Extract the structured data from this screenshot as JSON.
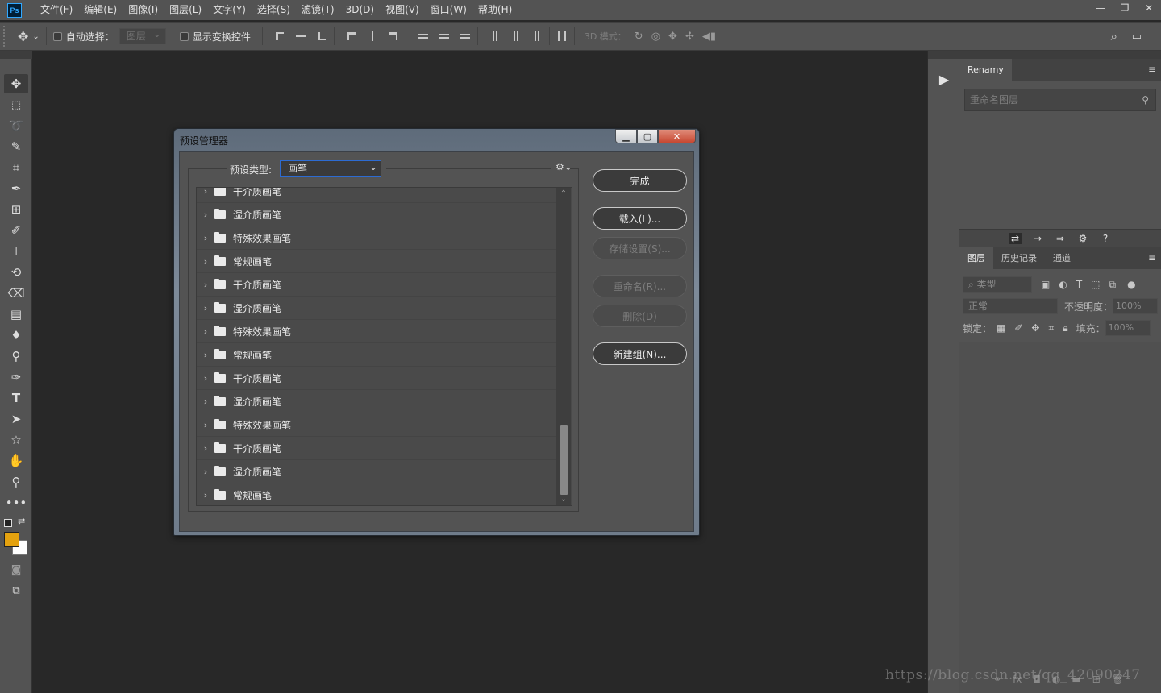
{
  "app": {
    "logo_text": "Ps",
    "menus": [
      "文件(F)",
      "编辑(E)",
      "图像(I)",
      "图层(L)",
      "文字(Y)",
      "选择(S)",
      "滤镜(T)",
      "3D(D)",
      "视图(V)",
      "窗口(W)",
      "帮助(H)"
    ],
    "window_controls": [
      "—",
      "❐",
      "✕"
    ]
  },
  "options_bar": {
    "auto_select_label": "自动选择：",
    "auto_select_value": "图层",
    "show_transform_label": "显示变换控件",
    "mode_3d_label": "3D 模式："
  },
  "right_panel": {
    "renamy_tab": "Renamy",
    "rename_placeholder": "重命名图层",
    "layer_tabs": [
      "图层",
      "历史记录",
      "通道"
    ],
    "kind_filter": "类型",
    "blend_mode": "正常",
    "opacity_label": "不透明度：",
    "opacity_value": "100%",
    "lock_label": "锁定：",
    "fill_label": "填充：",
    "fill_value": "100%"
  },
  "dialog": {
    "title": "预设管理器",
    "preset_type_label": "预设类型:",
    "preset_type_value": "画笔",
    "items": [
      "干介质画笔",
      "湿介质画笔",
      "特殊效果画笔",
      "常规画笔",
      "干介质画笔",
      "湿介质画笔",
      "特殊效果画笔",
      "常规画笔",
      "干介质画笔",
      "湿介质画笔",
      "特殊效果画笔",
      "干介质画笔",
      "湿介质画笔",
      "常规画笔"
    ],
    "buttons": {
      "done": "完成",
      "load": "载入(L)...",
      "save": "存储设置(S)...",
      "rename": "重命名(R)...",
      "delete": "删除(D)",
      "new_group": "新建组(N)..."
    }
  },
  "watermark": "https://blog.csdn.net/qq_42090247",
  "colors": {
    "foreground": "#e4a20f",
    "background": "#ffffff"
  }
}
